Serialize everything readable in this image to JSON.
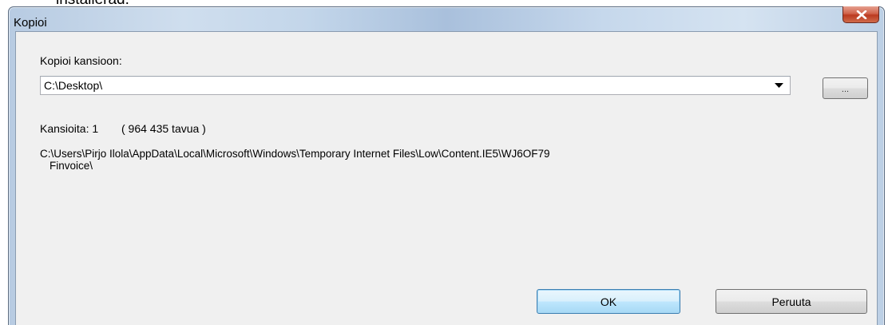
{
  "background_text": "installerad.",
  "window": {
    "title": "Kopioi"
  },
  "form": {
    "target_label": "Kopioi kansioon:",
    "target_value": "C:\\Desktop\\",
    "browse_label": "...",
    "folders_label": "Kansioita:",
    "folders_count": "1",
    "size_text": "( 964 435 tavua )",
    "source_path_line1": "C:\\Users\\Pirjo Ilola\\AppData\\Local\\Microsoft\\Windows\\Temporary Internet Files\\Low\\Content.IE5\\WJ6OF79",
    "source_path_line2": "Finvoice\\"
  },
  "buttons": {
    "ok_label": "OK",
    "cancel_label": "Peruuta"
  },
  "colors": {
    "title_gradient": "#b7cbe2",
    "close_button": "#c9462c",
    "client_background": "#f0f0f0",
    "default_button_border": "#3c7fb1"
  },
  "icons": {
    "close": "close-icon",
    "dropdown": "chevron-down-icon"
  }
}
